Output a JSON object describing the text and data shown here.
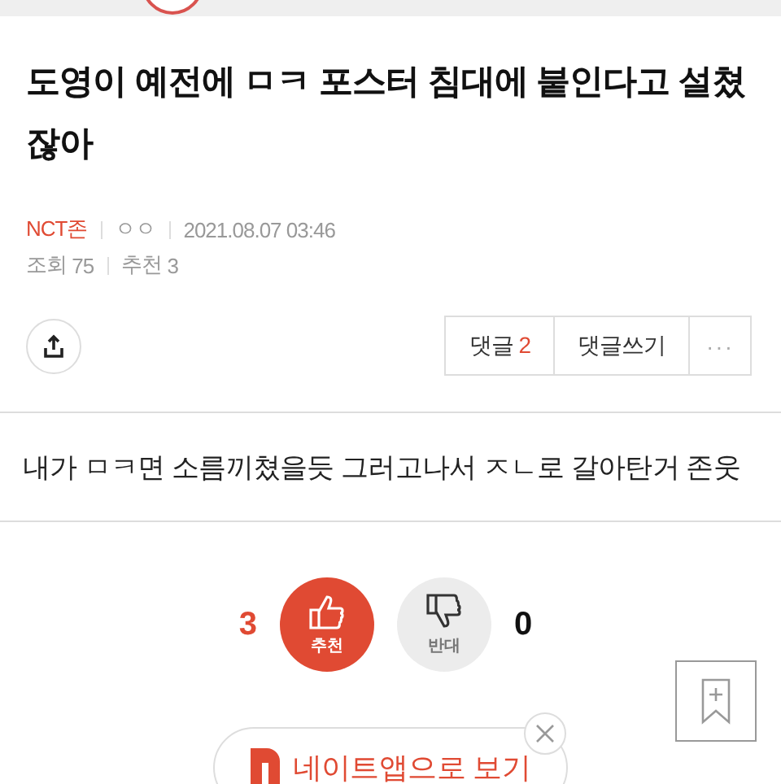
{
  "title": "도영이 예전에 ㅁㅋ 포스터 침대에 붙인다고 설쳤잖아",
  "meta": {
    "board": "NCT존",
    "author": "ㅇㅇ",
    "date": "2021.08.07 03:46",
    "views_label": "조회",
    "views": "75",
    "recommend_label": "추천",
    "recommend": "3"
  },
  "toolbar": {
    "comments_label": "댓글",
    "comments_count": "2",
    "write_comment": "댓글쓰기",
    "more": "···"
  },
  "body": "내가 ㅁㅋ면 소름끼쳤을듯 그러고나서 ㅈㄴ로 갈아탄거 존웃",
  "votes": {
    "up_count": "3",
    "up_label": "추천",
    "down_label": "반대",
    "down_count": "0"
  },
  "app_banner": {
    "label": "네이트앱으로 보기"
  }
}
